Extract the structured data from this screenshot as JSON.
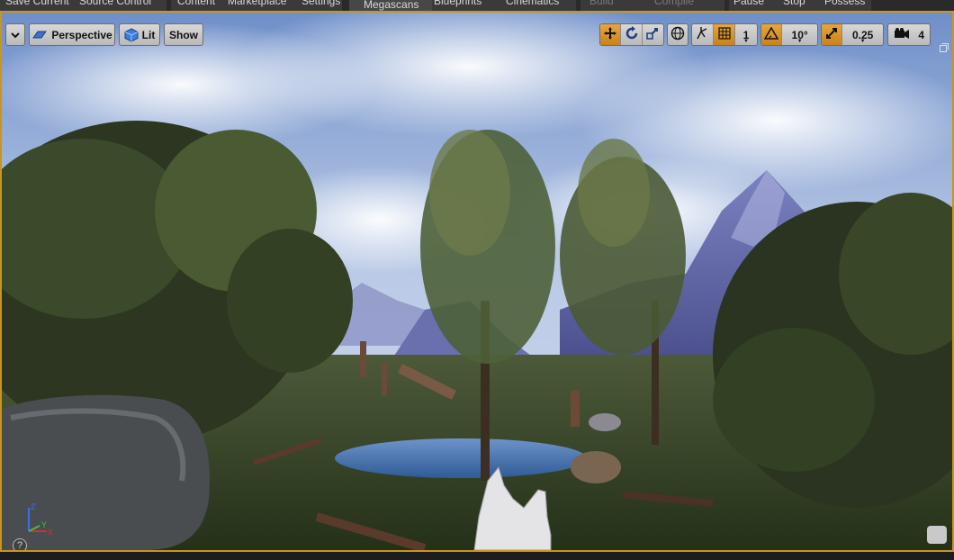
{
  "topbar": {
    "items": [
      {
        "label": "Save Current",
        "dim": false
      },
      {
        "label": "Source Control",
        "dim": false
      },
      {
        "label": "Content",
        "dim": false
      },
      {
        "label": "Marketplace",
        "dim": false
      },
      {
        "label": "Settings",
        "dim": false
      },
      {
        "label": "Megascans",
        "dim": false
      },
      {
        "label": "Blueprints",
        "dim": false
      },
      {
        "label": "Cinematics",
        "dim": false
      },
      {
        "label": "Build",
        "dim": true
      },
      {
        "label": "Compile",
        "dim": true
      },
      {
        "label": "Pause",
        "dim": false
      },
      {
        "label": "Stop",
        "dim": false
      },
      {
        "label": "Possess",
        "dim": false
      }
    ]
  },
  "viewport": {
    "view_mode": "Perspective",
    "lighting_mode": "Lit",
    "show_label": "Show",
    "grid_snap_value": "1",
    "rotation_snap_value": "10°",
    "scale_snap_value": "0.25",
    "camera_speed_value": "4",
    "help_glyph": "?",
    "axis_labels": {
      "x": "X",
      "y": "Y",
      "z": "Z"
    },
    "colors": {
      "border": "#c8951e",
      "active": "#e7a53a"
    }
  }
}
